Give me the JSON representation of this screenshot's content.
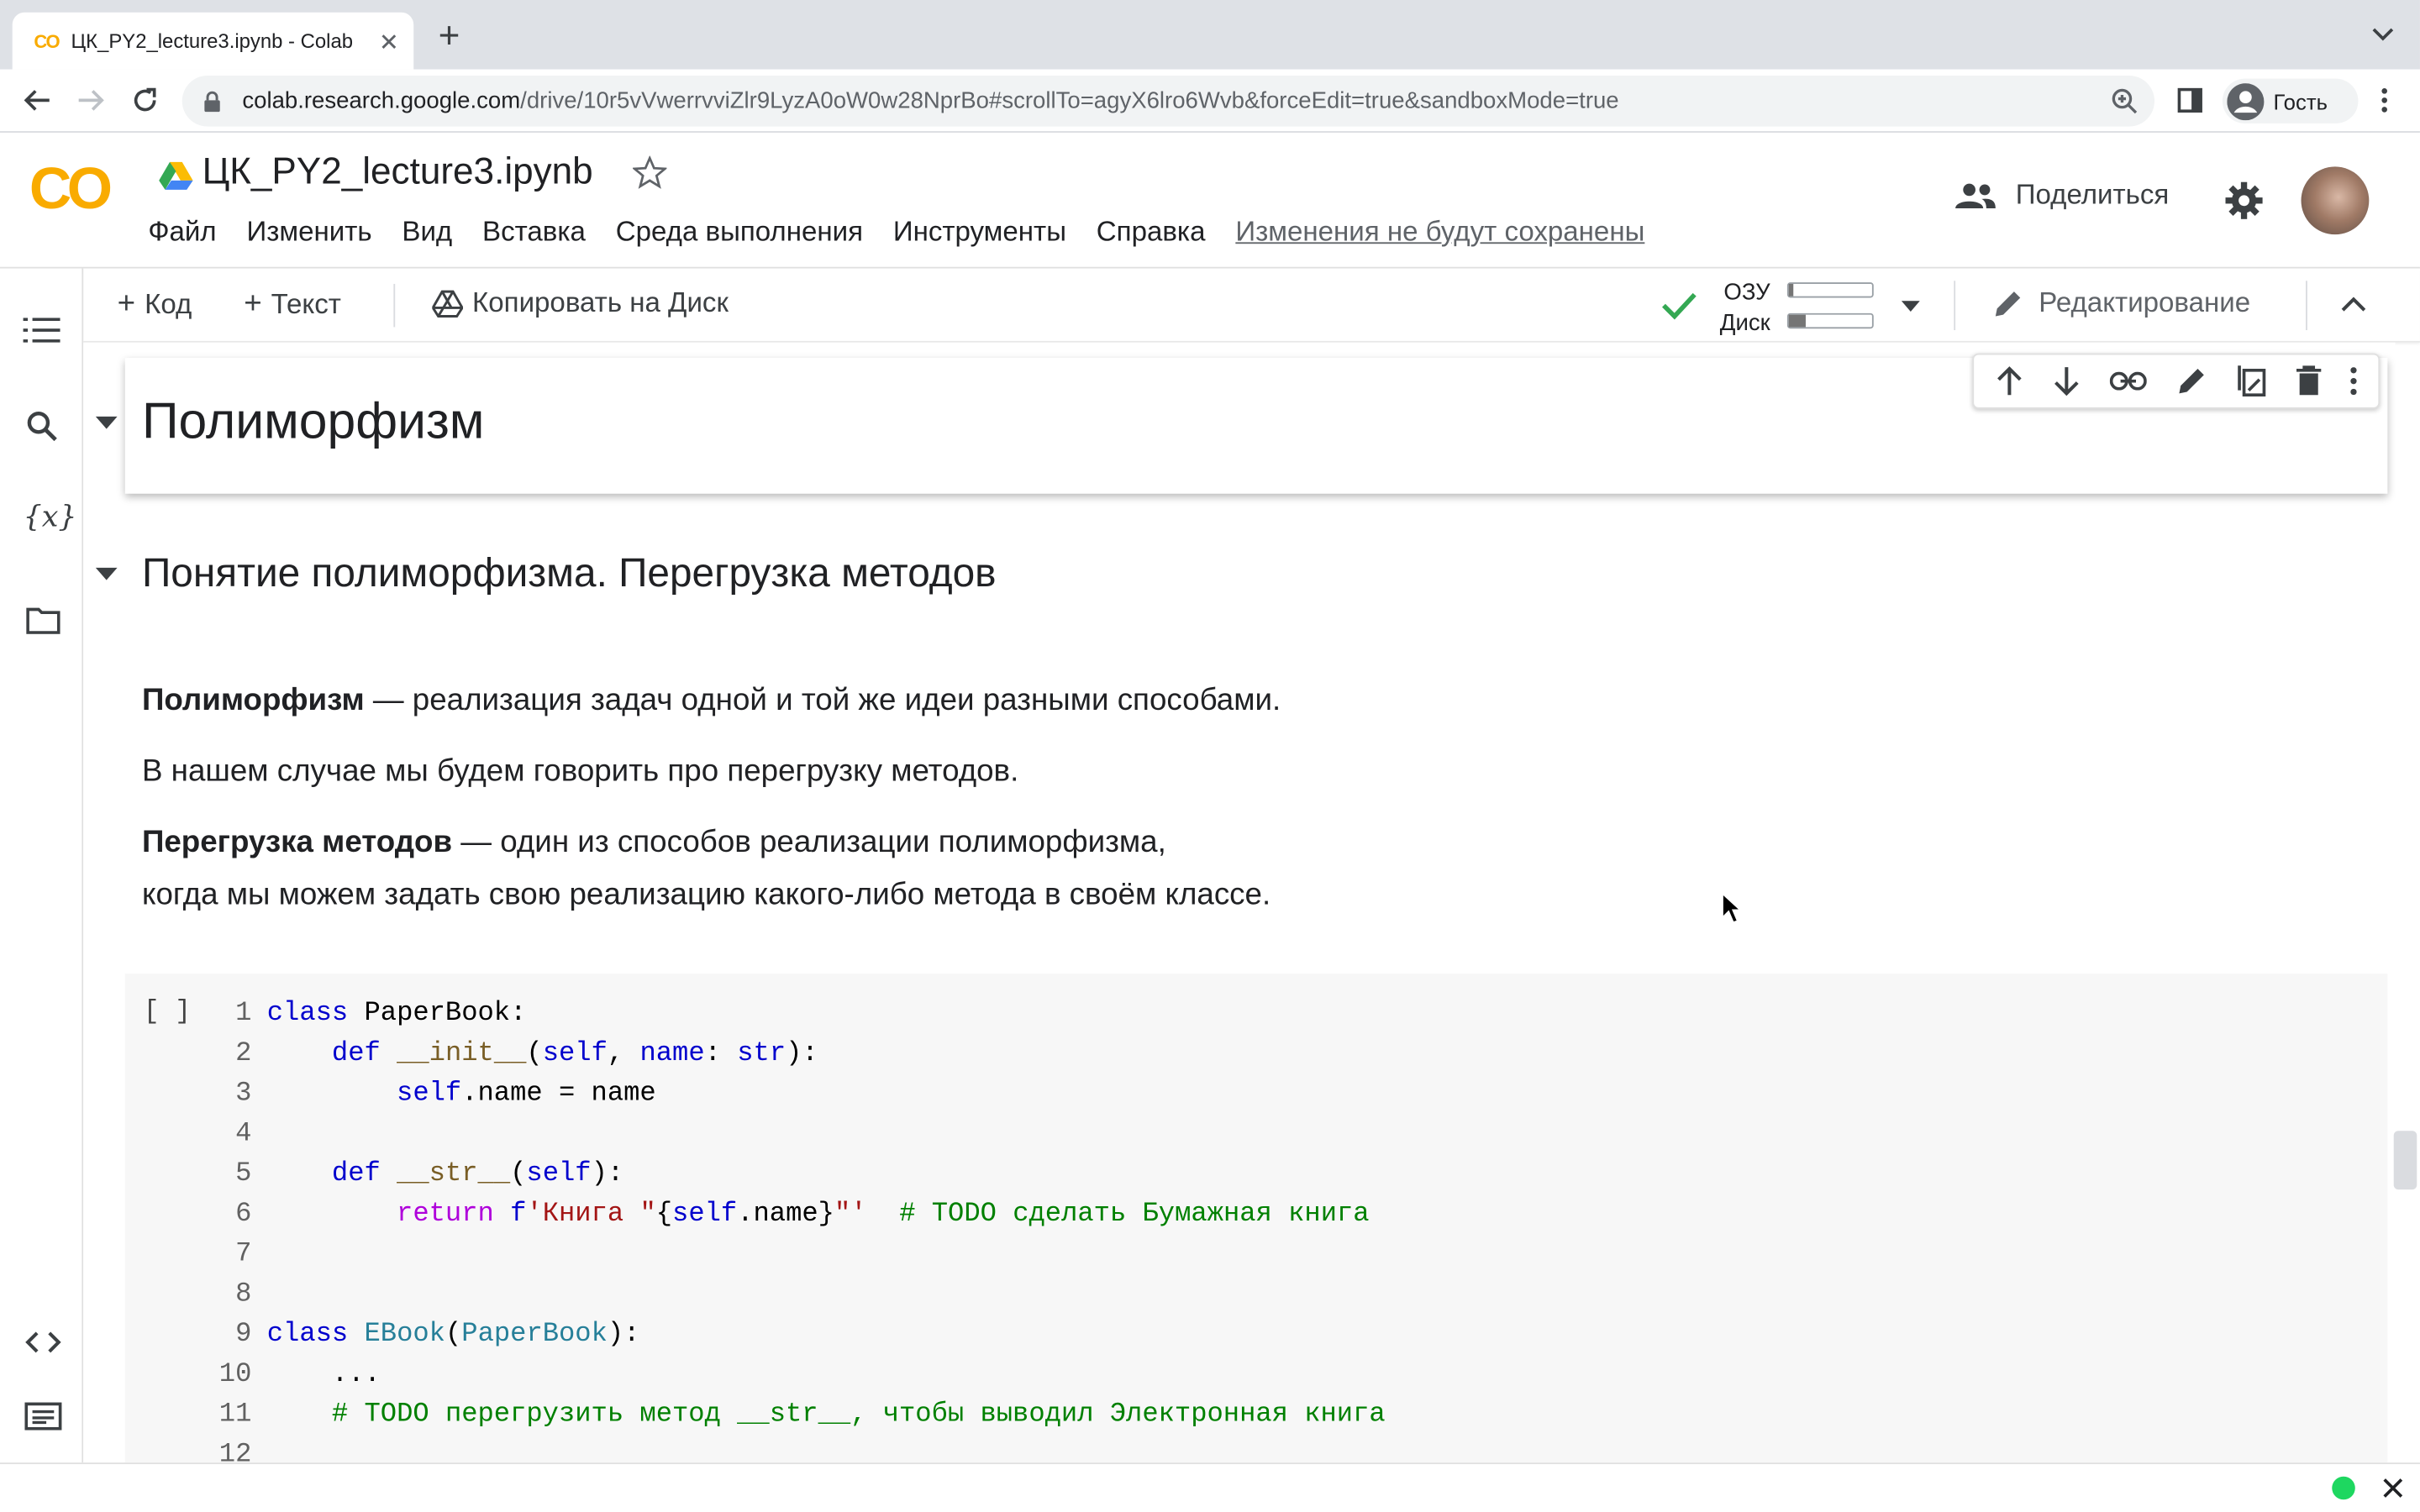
{
  "browser": {
    "tab_title": "ЦК_PY2_lecture3.ipynb - Colab",
    "new_tab": "+",
    "url_host": "colab.research.google.com",
    "url_path": "/drive/10r5vVwerrvviZlr9LyzA0oW0w28NprBo#scrollTo=agyX6lro6Wvb&forceEdit=true&sandboxMode=true",
    "profile_label": "Гость"
  },
  "colab": {
    "logo_text": "CO",
    "notebook_title": "ЦК_PY2_lecture3.ipynb",
    "menu": [
      "Файл",
      "Изменить",
      "Вид",
      "Вставка",
      "Среда выполнения",
      "Инструменты",
      "Справка"
    ],
    "unsaved_notice": "Изменения не будут сохранены",
    "share_label": "Поделиться"
  },
  "toolbar": {
    "add_code": "Код",
    "add_text": "Текст",
    "copy_to_drive": "Копировать на Диск",
    "ram_label": "ОЗУ",
    "disk_label": "Диск",
    "ram_usage": 0.05,
    "disk_usage": 0.2,
    "editing_label": "Редактирование"
  },
  "notebook": {
    "heading1": "Полиморфизм",
    "heading2": "Понятие полиморфизма. Перегрузка методов",
    "para1_bold": "Полиморфизм",
    "para1_rest": " — реализация задач одной и той же идеи разными способами.",
    "para2": "В нашем случае мы будем говорить про перегрузку методов.",
    "para3_bold": "Перегрузка методов",
    "para3_rest": " — один из способов реализации полиморфизма,",
    "para3_line2": "когда мы можем задать свою реализацию какого-либо метода в своём классе.",
    "run_bracket": "[ ]",
    "line_numbers": [
      "1",
      "2",
      "3",
      "4",
      "5",
      "6",
      "7",
      "8",
      "9",
      "10",
      "11",
      "12"
    ],
    "code": {
      "l1_kw": "class",
      "l1_rest": " PaperBook:",
      "l2_indent": "    ",
      "l2_kw": "def",
      "l2_fn": " __init__",
      "l2_p1": "(",
      "l2_self": "self",
      "l2_p2": ", ",
      "l2_name": "name",
      "l2_p3": ": ",
      "l2_type": "str",
      "l2_p4": "):",
      "l3_indent": "        ",
      "l3_self": "self",
      "l3_rest": ".name = name",
      "l5_indent": "    ",
      "l5_kw": "def",
      "l5_fn": " __str__",
      "l5_p1": "(",
      "l5_self": "self",
      "l5_p2": "):",
      "l6_indent": "        ",
      "l6_ret": "return",
      "l6_sp": " ",
      "l6_f": "f",
      "l6_str1": "'Книга \"",
      "l6_brace1": "{",
      "l6_self": "self",
      "l6_attr": ".name",
      "l6_brace2": "}",
      "l6_str2": "\"'",
      "l6_sp2": "  ",
      "l6_comment": "# TODO сделать Бумажная книга",
      "l9_kw": "class",
      "l9_sp": " ",
      "l9_cls": "EBook",
      "l9_p1": "(",
      "l9_base": "PaperBook",
      "l9_p2": "):",
      "l10": "    ...",
      "l11_indent": "    ",
      "l11_comment": "# TODO перегрузить метод __str__, чтобы выводил Электронная книга"
    }
  }
}
